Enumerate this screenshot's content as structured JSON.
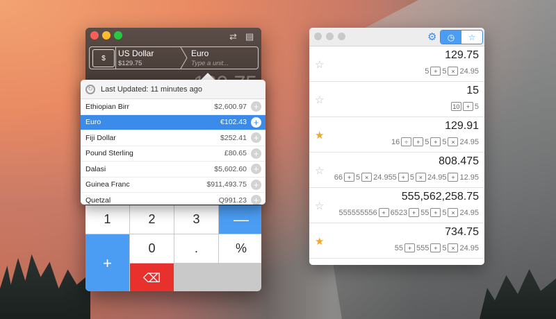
{
  "calculator": {
    "from_currency": "US Dollar",
    "from_amount": "$129.75",
    "to_currency": "Euro",
    "to_placeholder": "Type a unit...",
    "display_value": "129.75",
    "keys": {
      "one": "1",
      "two": "2",
      "three": "3",
      "minus": "—",
      "zero": "0",
      "dot": ".",
      "percent": "%",
      "plus": "+",
      "equals": "="
    }
  },
  "popover": {
    "last_updated_label": "Last Updated:",
    "last_updated_value": "11 minutes ago",
    "rows": [
      {
        "label": "Ethiopian Birr",
        "value": "$2,600.97"
      },
      {
        "label": "Euro",
        "value": "€102.43"
      },
      {
        "label": "Fiji Dollar",
        "value": "$252.41"
      },
      {
        "label": "Pound Sterling",
        "value": "£80.65"
      },
      {
        "label": "Dalasi",
        "value": "$5,602.60"
      },
      {
        "label": "Guinea Franc",
        "value": "$911,493.75"
      },
      {
        "label": "Quetzal",
        "value": "Q991.23"
      }
    ],
    "selected_index": 1
  },
  "history": {
    "entries": [
      {
        "result": "129.75",
        "starred": false,
        "expr": [
          "5",
          "+",
          "5",
          "×",
          "24.95"
        ]
      },
      {
        "result": "15",
        "starred": false,
        "expr": [
          "10",
          "+",
          "5"
        ]
      },
      {
        "result": "129.91",
        "starred": true,
        "expr": [
          "16",
          "÷",
          "+",
          "5",
          "+",
          "5",
          "×",
          "24.95"
        ]
      },
      {
        "result": "808.475",
        "starred": false,
        "expr": [
          "66",
          "+",
          "5",
          "×",
          "24.955",
          "+",
          "5",
          "×",
          "24.95",
          "+",
          "12.95"
        ]
      },
      {
        "result": "555,562,258.75",
        "starred": false,
        "expr": [
          "555555556",
          "+",
          "6523",
          "+",
          "55",
          "+",
          "5",
          "×",
          "24.95"
        ]
      },
      {
        "result": "734.75",
        "starred": true,
        "expr": [
          "55",
          "+",
          "555",
          "+",
          "5",
          "×",
          "24.95"
        ]
      }
    ]
  },
  "icons": {
    "swap": "⇄",
    "list": "▤",
    "gear": "⚙",
    "clock": "🕒",
    "star_outline": "☆",
    "star_filled": "★",
    "refresh": "↻",
    "backspace": "⌫",
    "bill": "$"
  },
  "colors": {
    "accent": "#3b8bea",
    "delete": "#e8312c",
    "equals": "#f6941f",
    "star": "#f5a623"
  }
}
